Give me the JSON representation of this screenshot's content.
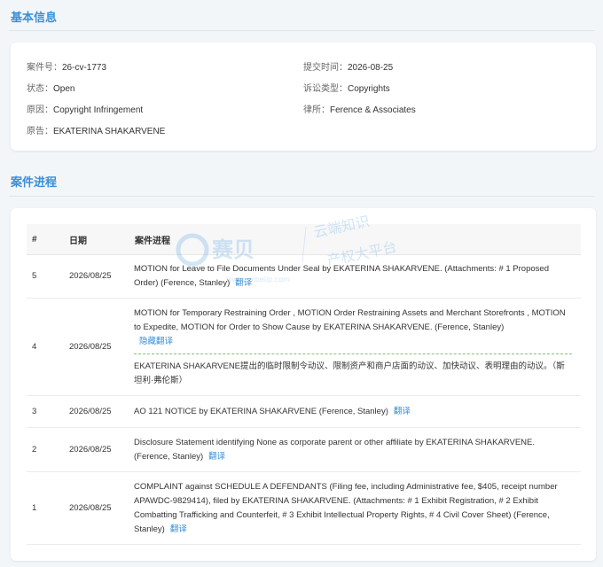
{
  "basic_info": {
    "title": "基本信息",
    "case_no": {
      "label": "案件号：",
      "value": "26-cv-1773"
    },
    "submit_time": {
      "label": "提交时间：",
      "value": "2026-08-25"
    },
    "status": {
      "label": "状态：",
      "value": "Open"
    },
    "litigation_type": {
      "label": "诉讼类型：",
      "value": "Copyrights"
    },
    "cause": {
      "label": "原因：",
      "value": "Copyright Infringement"
    },
    "law_firm": {
      "label": "律所：",
      "value": "Ference & Associates"
    },
    "plaintiff": {
      "label": "原告：",
      "value": "EKATERINA SHAKARVENE"
    }
  },
  "progress": {
    "title": "案件进程",
    "headers": {
      "num": "#",
      "date": "日期",
      "progress": "案件进程"
    },
    "rows": [
      {
        "num": "5",
        "date": "2026/08/25",
        "text": "MOTION for Leave to File Documents Under Seal by EKATERINA SHAKARVENE. (Attachments: # 1 Proposed Order) (Ference, Stanley)",
        "action": "翻译"
      },
      {
        "num": "4",
        "date": "2026/08/25",
        "text": "MOTION for Temporary Restraining Order , MOTION Order Restraining Assets and Merchant Storefronts , MOTION to Expedite, MOTION for Order to Show Cause by EKATERINA SHAKARVENE. (Ference, Stanley)",
        "action": "隐藏翻译",
        "translation": "EKATERINA SHAKARVENE提出的临时限制令动议、限制资产和商户店面的动议、加快动议、表明理由的动议。（斯坦利·弗伦斯）"
      },
      {
        "num": "3",
        "date": "2026/08/25",
        "text": "AO 121 NOTICE by EKATERINA SHAKARVENE (Ference, Stanley)",
        "action": "翻译"
      },
      {
        "num": "2",
        "date": "2026/08/25",
        "text": "Disclosure Statement identifying None as corporate parent or other affiliate by EKATERINA SHAKARVENE. (Ference, Stanley)",
        "action": "翻译"
      },
      {
        "num": "1",
        "date": "2026/08/25",
        "text": "COMPLAINT against SCHEDULE A DEFENDANTS (Filing fee, including Administrative fee, $405, receipt number APAWDC-9829414), filed by EKATERINA SHAKARVENE. (Attachments: # 1 Exhibit Registration, # 2 Exhibit Combatting Trafficking and Counterfeit, # 3 Exhibit Intellectual Property Rights, # 4 Civil Cover Sheet) (Ference, Stanley)",
        "action": "翻译"
      }
    ]
  },
  "watermark": {
    "brand": "赛贝",
    "slogan1": "云端知识",
    "slogan2": "产权大平台",
    "url": "www.saibeiip.com"
  },
  "colors": {
    "accent": "#3a8fd6",
    "background": "#f3f6f9"
  }
}
